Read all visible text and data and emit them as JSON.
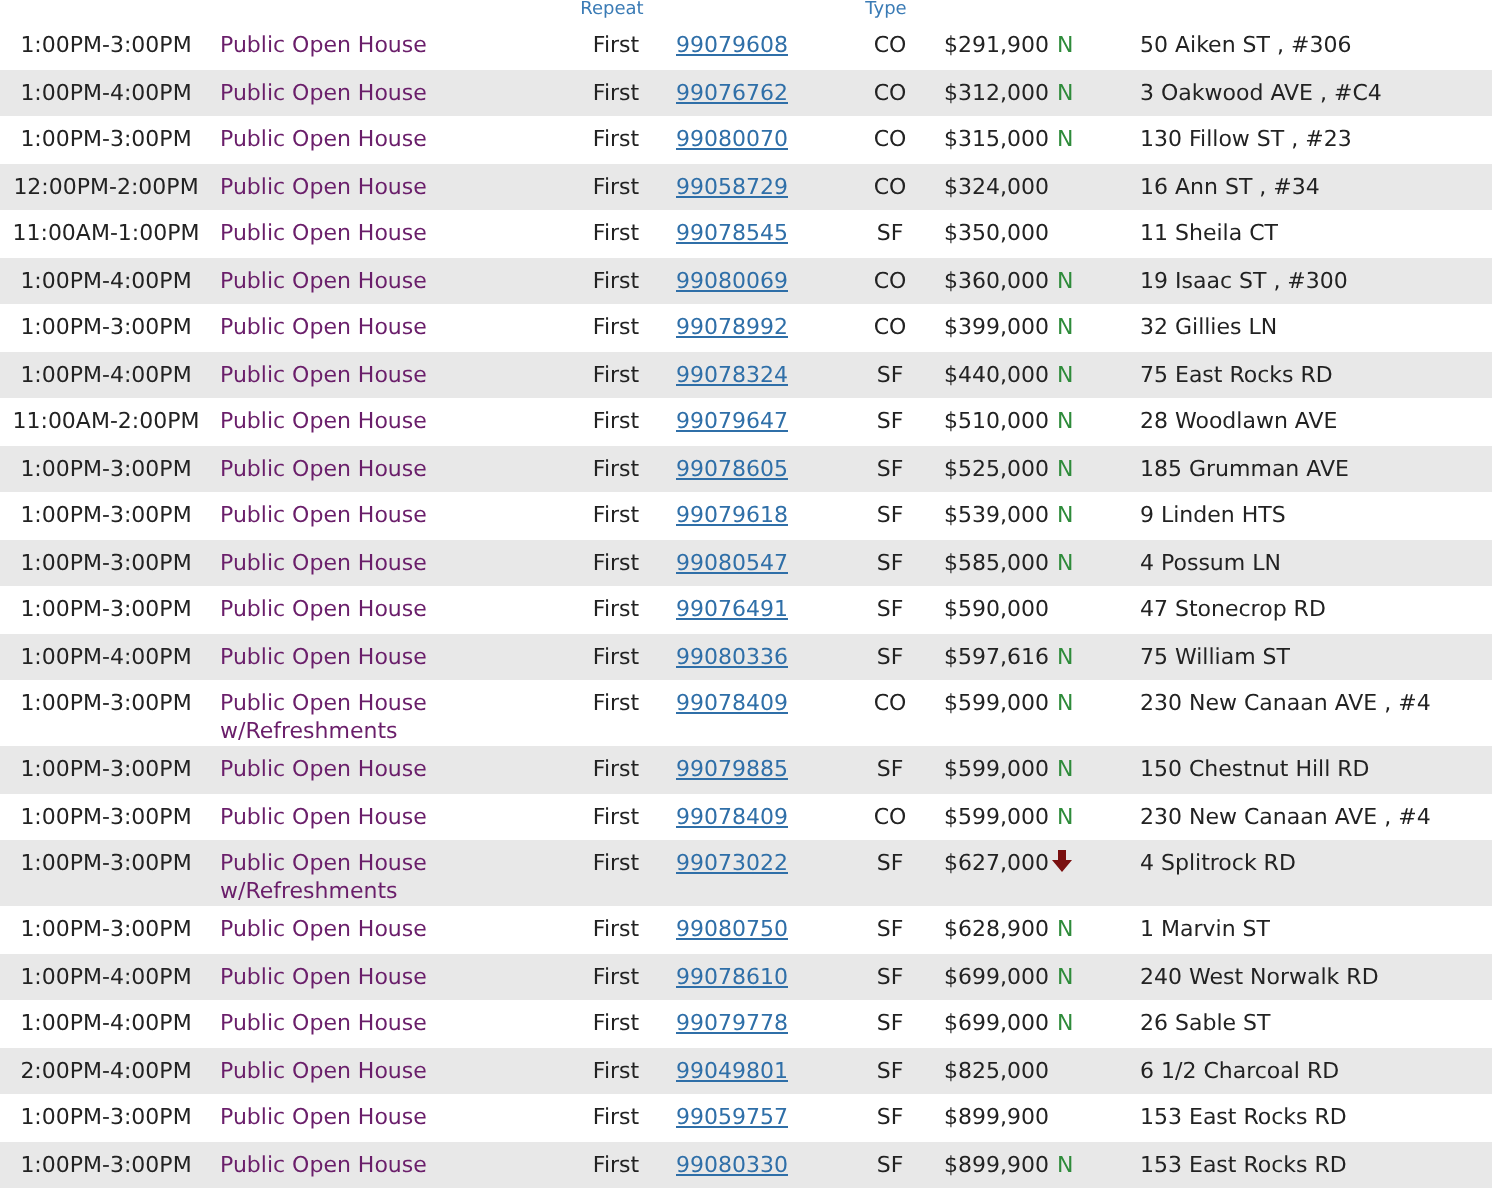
{
  "table": {
    "headers": {
      "repeat": "Repeat",
      "type": "Type"
    },
    "rows": [
      {
        "time": "1:00PM-3:00PM",
        "event": "Public Open House",
        "repeat": "First",
        "mls": "99079608",
        "type": "CO",
        "price": "$291,900",
        "flag": {
          "kind": "new",
          "text": "N"
        },
        "address": "50 Aiken ST , #306"
      },
      {
        "time": "1:00PM-4:00PM",
        "event": "Public Open House",
        "repeat": "First",
        "mls": "99076762",
        "type": "CO",
        "price": "$312,000",
        "flag": {
          "kind": "new",
          "text": "N"
        },
        "address": "3 Oakwood AVE , #C4"
      },
      {
        "time": "1:00PM-3:00PM",
        "event": "Public Open House",
        "repeat": "First",
        "mls": "99080070",
        "type": "CO",
        "price": "$315,000",
        "flag": {
          "kind": "new",
          "text": "N"
        },
        "address": "130 Fillow ST , #23"
      },
      {
        "time": "12:00PM-2:00PM",
        "event": "Public Open House",
        "repeat": "First",
        "mls": "99058729",
        "type": "CO",
        "price": "$324,000",
        "address": "16 Ann ST , #34"
      },
      {
        "time": "11:00AM-1:00PM",
        "event": "Public Open House",
        "repeat": "First",
        "mls": "99078545",
        "type": "SF",
        "price": "$350,000",
        "address": "11 Sheila CT"
      },
      {
        "time": "1:00PM-4:00PM",
        "event": "Public Open House",
        "repeat": "First",
        "mls": "99080069",
        "type": "CO",
        "price": "$360,000",
        "flag": {
          "kind": "new",
          "text": "N"
        },
        "address": "19 Isaac ST , #300"
      },
      {
        "time": "1:00PM-3:00PM",
        "event": "Public Open House",
        "repeat": "First",
        "mls": "99078992",
        "type": "CO",
        "price": "$399,000",
        "flag": {
          "kind": "new",
          "text": "N"
        },
        "address": "32 Gillies LN"
      },
      {
        "time": "1:00PM-4:00PM",
        "event": "Public Open House",
        "repeat": "First",
        "mls": "99078324",
        "type": "SF",
        "price": "$440,000",
        "flag": {
          "kind": "new",
          "text": "N"
        },
        "address": "75 East Rocks RD"
      },
      {
        "time": "11:00AM-2:00PM",
        "event": "Public Open House",
        "repeat": "First",
        "mls": "99079647",
        "type": "SF",
        "price": "$510,000",
        "flag": {
          "kind": "new",
          "text": "N"
        },
        "address": "28 Woodlawn AVE"
      },
      {
        "time": "1:00PM-3:00PM",
        "event": "Public Open House",
        "repeat": "First",
        "mls": "99078605",
        "type": "SF",
        "price": "$525,000",
        "flag": {
          "kind": "new",
          "text": "N"
        },
        "address": "185 Grumman AVE"
      },
      {
        "time": "1:00PM-3:00PM",
        "event": "Public Open House",
        "repeat": "First",
        "mls": "99079618",
        "type": "SF",
        "price": "$539,000",
        "flag": {
          "kind": "new",
          "text": "N"
        },
        "address": "9 Linden HTS"
      },
      {
        "time": "1:00PM-3:00PM",
        "event": "Public Open House",
        "repeat": "First",
        "mls": "99080547",
        "type": "SF",
        "price": "$585,000",
        "flag": {
          "kind": "new",
          "text": "N"
        },
        "address": "4 Possum LN"
      },
      {
        "time": "1:00PM-3:00PM",
        "event": "Public Open House",
        "repeat": "First",
        "mls": "99076491",
        "type": "SF",
        "price": "$590,000",
        "address": "47 Stonecrop RD"
      },
      {
        "time": "1:00PM-4:00PM",
        "event": "Public Open House",
        "repeat": "First",
        "mls": "99080336",
        "type": "SF",
        "price": "$597,616",
        "flag": {
          "kind": "new",
          "text": "N"
        },
        "address": "75 William ST"
      },
      {
        "time": "1:00PM-3:00PM",
        "event": "Public Open House w/Refreshments",
        "repeat": "First",
        "mls": "99078409",
        "type": "CO",
        "price": "$599,000",
        "flag": {
          "kind": "new",
          "text": "N"
        },
        "address": "230 New Canaan AVE , #4"
      },
      {
        "time": "1:00PM-3:00PM",
        "event": "Public Open House",
        "repeat": "First",
        "mls": "99079885",
        "type": "SF",
        "price": "$599,000",
        "flag": {
          "kind": "new",
          "text": "N"
        },
        "address": "150 Chestnut Hill RD"
      },
      {
        "time": "1:00PM-3:00PM",
        "event": "Public Open House",
        "repeat": "First",
        "mls": "99078409",
        "type": "CO",
        "price": "$599,000",
        "flag": {
          "kind": "new",
          "text": "N"
        },
        "address": "230 New Canaan AVE , #4"
      },
      {
        "time": "1:00PM-3:00PM",
        "event": "Public Open House w/Refreshments",
        "repeat": "First",
        "mls": "99073022",
        "type": "SF",
        "price": "$627,000",
        "flag": {
          "kind": "reduced"
        },
        "address": "4 Splitrock RD"
      },
      {
        "time": "1:00PM-3:00PM",
        "event": "Public Open House",
        "repeat": "First",
        "mls": "99080750",
        "type": "SF",
        "price": "$628,900",
        "flag": {
          "kind": "new",
          "text": "N"
        },
        "address": "1 Marvin ST"
      },
      {
        "time": "1:00PM-4:00PM",
        "event": "Public Open House",
        "repeat": "First",
        "mls": "99078610",
        "type": "SF",
        "price": "$699,000",
        "flag": {
          "kind": "new",
          "text": "N"
        },
        "address": "240 West Norwalk RD"
      },
      {
        "time": "1:00PM-4:00PM",
        "event": "Public Open House",
        "repeat": "First",
        "mls": "99079778",
        "type": "SF",
        "price": "$699,000",
        "flag": {
          "kind": "new",
          "text": "N"
        },
        "address": "26 Sable ST"
      },
      {
        "time": "2:00PM-4:00PM",
        "event": "Public Open House",
        "repeat": "First",
        "mls": "99049801",
        "type": "SF",
        "price": "$825,000",
        "address": "6 1/2 Charcoal RD"
      },
      {
        "time": "1:00PM-3:00PM",
        "event": "Public Open House",
        "repeat": "First",
        "mls": "99059757",
        "type": "SF",
        "price": "$899,900",
        "address": "153 East Rocks RD"
      },
      {
        "time": "1:00PM-3:00PM",
        "event": "Public Open House",
        "repeat": "First",
        "mls": "99080330",
        "type": "SF",
        "price": "$899,900",
        "flag": {
          "kind": "new",
          "text": "N"
        },
        "address": "153 East Rocks RD"
      }
    ]
  }
}
